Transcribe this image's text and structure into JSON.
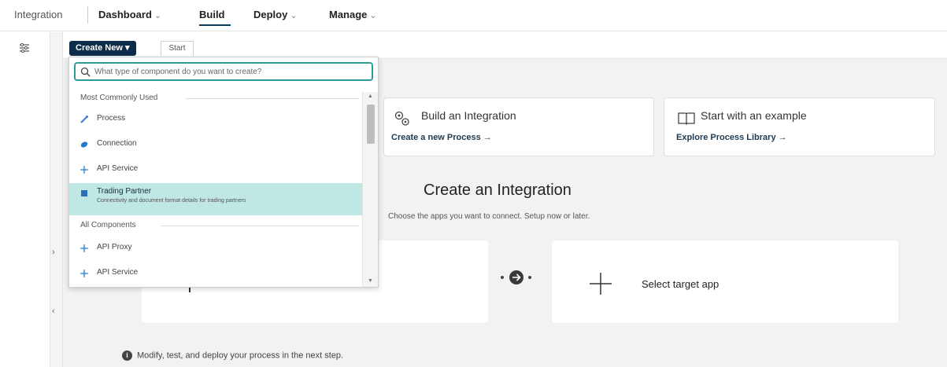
{
  "topnav": {
    "brand": "Integration",
    "items": [
      {
        "label": "Dashboard",
        "caret": "⌄"
      },
      {
        "label": "Build",
        "caret": ""
      },
      {
        "label": "Deploy",
        "caret": "⌄"
      },
      {
        "label": "Manage",
        "caret": "⌄"
      }
    ]
  },
  "toolbar": {
    "create_new_label": "Create New ▾",
    "start_tab_label": "Start"
  },
  "dropdown": {
    "search_placeholder": "What type of component do you want to create?",
    "group_common": "Most Commonly Used",
    "group_all": "All Components",
    "common_items": [
      {
        "label": "Process",
        "icon": "process-icon"
      },
      {
        "label": "Connection",
        "icon": "connection-icon"
      },
      {
        "label": "API Service",
        "icon": "api-service-icon"
      },
      {
        "label": "Trading Partner",
        "icon": "trading-partner-icon",
        "description": "Connectivity and document format details for trading partners",
        "selected": true
      }
    ],
    "all_items": [
      {
        "label": "API Proxy",
        "icon": "api-proxy-icon"
      },
      {
        "label": "API Service",
        "icon": "api-service-icon"
      }
    ]
  },
  "cards": {
    "build": {
      "title": "Build an Integration",
      "link": "Create a new Process →"
    },
    "example": {
      "title": "Start with an example",
      "link": "Explore Process Library →"
    }
  },
  "section": {
    "title": "Create an Integration",
    "subtitle": "Choose the apps you want to connect. Setup now or later.",
    "target_label": "Select target app",
    "footnote": "Modify, test, and deploy your process in the next step."
  },
  "colors": {
    "primary_navy": "#0b2d4a",
    "accent_teal": "#2e9c96",
    "selected_bg": "#bfe7e3"
  }
}
